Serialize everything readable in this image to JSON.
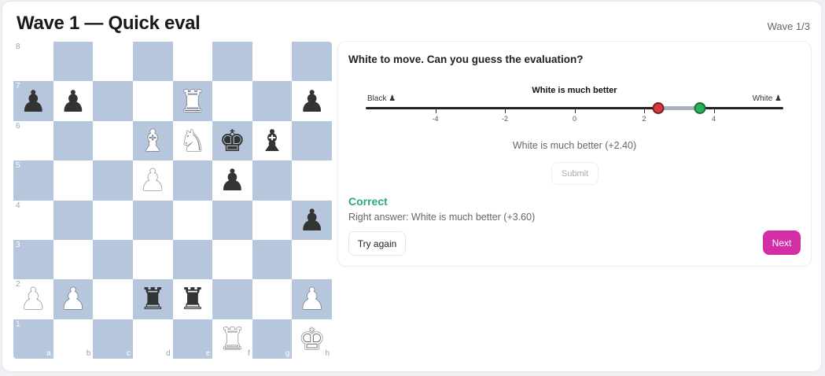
{
  "header": {
    "title": "Wave 1 — Quick eval",
    "wave_indicator": "Wave 1/3"
  },
  "board": {
    "files": [
      "a",
      "b",
      "c",
      "d",
      "e",
      "f",
      "g",
      "h"
    ],
    "ranks": [
      "8",
      "7",
      "6",
      "5",
      "4",
      "3",
      "2",
      "1"
    ],
    "rows": [
      [
        "",
        "",
        "",
        "",
        "",
        "",
        "",
        ""
      ],
      [
        "bp",
        "bp",
        "",
        "",
        "wr",
        "",
        "",
        "bp"
      ],
      [
        "",
        "",
        "",
        "wb",
        "wn",
        "bk",
        "bb",
        ""
      ],
      [
        "",
        "",
        "",
        "wp",
        "",
        "bp",
        "",
        ""
      ],
      [
        "",
        "",
        "",
        "",
        "",
        "",
        "",
        "bp"
      ],
      [
        "",
        "",
        "",
        "",
        "",
        "",
        "",
        ""
      ],
      [
        "wp",
        "wp",
        "",
        "br",
        "br",
        "",
        "",
        "wp"
      ],
      [
        "",
        "",
        "",
        "",
        "",
        "wr",
        "",
        "wk"
      ]
    ],
    "piece_glyphs": {
      "k": "♚",
      "q": "♛",
      "r": "♜",
      "b": "♝",
      "n": "♞",
      "p": "♟"
    },
    "light_color": "#ffffff",
    "dark_color": "#b6c6dc"
  },
  "panel": {
    "prompt": "White to move. Can you guess the evaluation?",
    "slider": {
      "label": "White is much better",
      "left_label": "Black ♟",
      "right_label": "White ♟",
      "min": -6,
      "max": 6,
      "ticks": [
        "-4",
        "-2",
        "0",
        "2",
        "4"
      ],
      "tick_values": [
        -4,
        -2,
        0,
        2,
        4
      ],
      "guess_value": 2.4,
      "answer_value": 3.6
    },
    "guess_text": "White is much better (+2.40)",
    "submit_label": "Submit",
    "result_label": "Correct",
    "answer_text": "Right answer: White is much better (+3.60)",
    "try_again_label": "Try again",
    "next_label": "Next",
    "accent_color": "#d42ea6",
    "correct_color": "#2daa73"
  }
}
